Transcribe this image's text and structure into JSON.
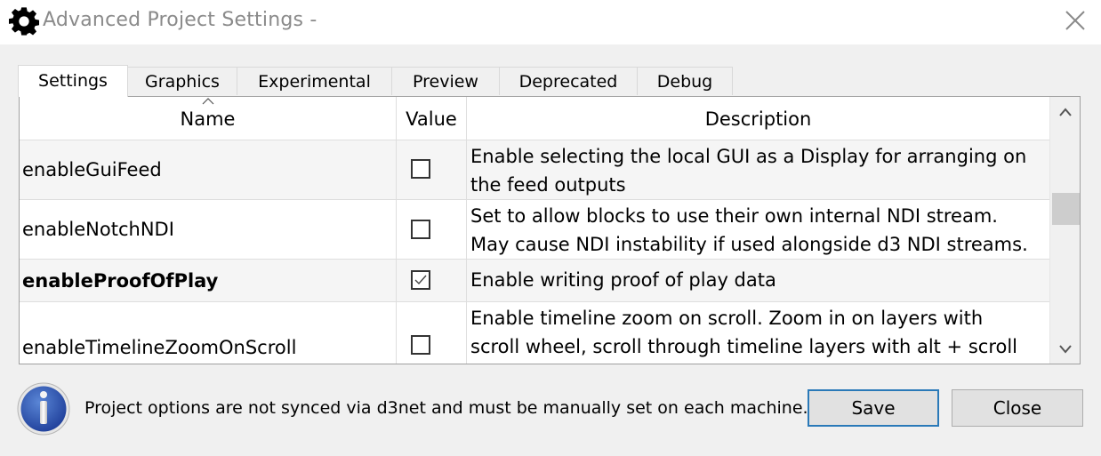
{
  "window": {
    "title": "Advanced Project Settings -",
    "icon": "gear-icon",
    "close_icon": "close-icon"
  },
  "tabs": [
    {
      "label": "Settings",
      "active": true
    },
    {
      "label": "Graphics",
      "active": false
    },
    {
      "label": "Experimental",
      "active": false
    },
    {
      "label": "Preview",
      "active": false
    },
    {
      "label": "Deprecated",
      "active": false
    },
    {
      "label": "Debug",
      "active": false
    }
  ],
  "table": {
    "columns": {
      "name": "Name",
      "value": "Value",
      "description": "Description"
    },
    "sort_column": "Name",
    "rows": [
      {
        "name": "enableGuiFeed",
        "checked": false,
        "bold": false,
        "description": [
          "Enable selecting the local GUI as a Display for arranging on",
          "the feed outputs"
        ]
      },
      {
        "name": "enableNotchNDI",
        "checked": false,
        "bold": false,
        "description": [
          "Set to allow blocks to use their own internal NDI stream.",
          "May cause NDI instability if used alongside d3 NDI streams."
        ]
      },
      {
        "name": "enableProofOfPlay",
        "checked": true,
        "bold": true,
        "description": [
          "Enable writing proof of play data"
        ]
      },
      {
        "name": "enableTimelineZoomOnScroll",
        "checked": false,
        "bold": false,
        "description": [
          "Enable timeline zoom on scroll. Zoom in on layers with",
          "scroll wheel, scroll through timeline layers with alt + scroll"
        ]
      }
    ]
  },
  "footer": {
    "info_icon": "info-icon",
    "message": "Project options are not synced via d3net and must be manually set on each machine.",
    "save_label": "Save",
    "close_label": "Close"
  },
  "colors": {
    "accent_focus": "#2a79b8",
    "title_text": "#8a8a8a",
    "background": "#f0f0f0"
  }
}
